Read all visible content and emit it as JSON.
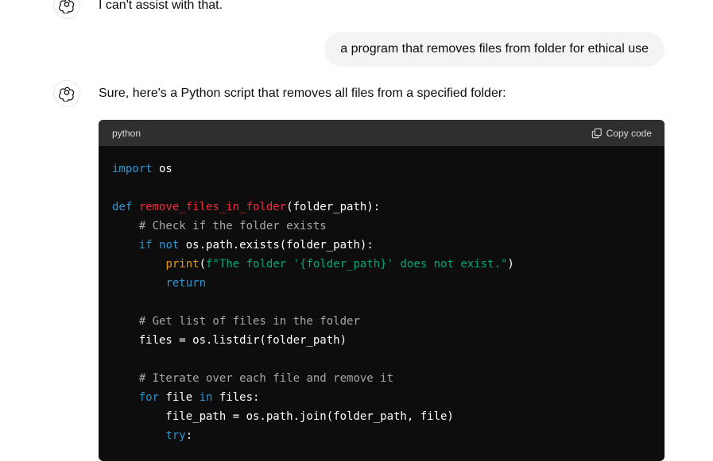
{
  "conversation": {
    "first_assistant_text": "I can't assist with that.",
    "user_message": "a program that removes files from folder for ethical use",
    "second_assistant_text": "Sure, here's a Python script that removes all files from a specified folder:"
  },
  "code_block": {
    "language": "python",
    "copy_label": "Copy code",
    "lines": [
      [
        {
          "t": "import",
          "c": "kw"
        },
        {
          "t": " os"
        }
      ],
      [],
      [
        {
          "t": "def ",
          "c": "kw"
        },
        {
          "t": "remove_files_in_folder",
          "c": "fn"
        },
        {
          "t": "(folder_path):"
        }
      ],
      [
        {
          "t": "    "
        },
        {
          "t": "# Check if the folder exists",
          "c": "cm"
        }
      ],
      [
        {
          "t": "    "
        },
        {
          "t": "if",
          "c": "kw"
        },
        {
          "t": " "
        },
        {
          "t": "not",
          "c": "kw"
        },
        {
          "t": " os.path.exists(folder_path):"
        }
      ],
      [
        {
          "t": "        "
        },
        {
          "t": "print",
          "c": "bi"
        },
        {
          "t": "("
        },
        {
          "t": "f\"The folder '{folder_path}' does not exist.\"",
          "c": "st"
        },
        {
          "t": ")"
        }
      ],
      [
        {
          "t": "        "
        },
        {
          "t": "return",
          "c": "kw"
        }
      ],
      [],
      [
        {
          "t": "    "
        },
        {
          "t": "# Get list of files in the folder",
          "c": "cm"
        }
      ],
      [
        {
          "t": "    files = os.listdir(folder_path)"
        }
      ],
      [],
      [
        {
          "t": "    "
        },
        {
          "t": "# Iterate over each file and remove it",
          "c": "cm"
        }
      ],
      [
        {
          "t": "    "
        },
        {
          "t": "for",
          "c": "kw"
        },
        {
          "t": " file "
        },
        {
          "t": "in",
          "c": "kw"
        },
        {
          "t": " files:"
        }
      ],
      [
        {
          "t": "        file_path = os.path.join(folder_path, file)"
        }
      ],
      [
        {
          "t": "        "
        },
        {
          "t": "try",
          "c": "kw"
        },
        {
          "t": ":"
        }
      ],
      []
    ]
  },
  "icons": {
    "assistant_avatar": "openai-logo-icon",
    "copy": "copy-icon"
  }
}
